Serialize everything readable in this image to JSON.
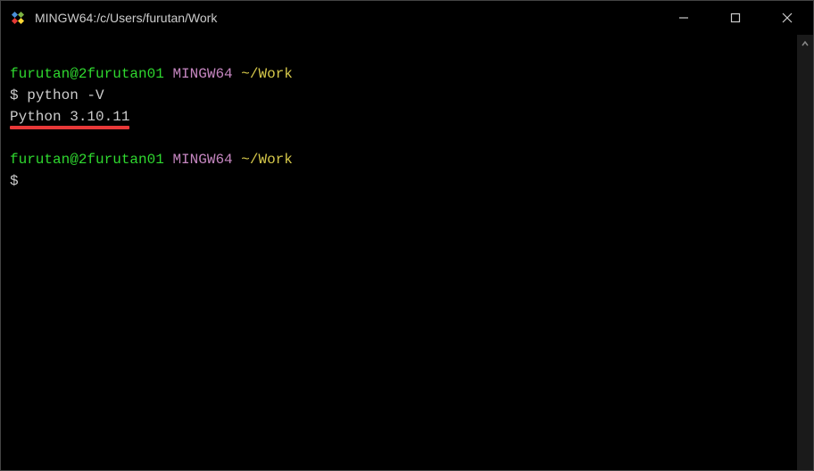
{
  "titlebar": {
    "title": "MINGW64:/c/Users/furutan/Work"
  },
  "terminal": {
    "prompt1": {
      "userHost": "furutan@2furutan01",
      "mingw": "MINGW64",
      "path": "~/Work",
      "dollar": "$",
      "command": "python -V"
    },
    "output1": "Python 3.10.11",
    "prompt2": {
      "userHost": "furutan@2furutan01",
      "mingw": "MINGW64",
      "path": "~/Work",
      "dollar": "$"
    }
  }
}
